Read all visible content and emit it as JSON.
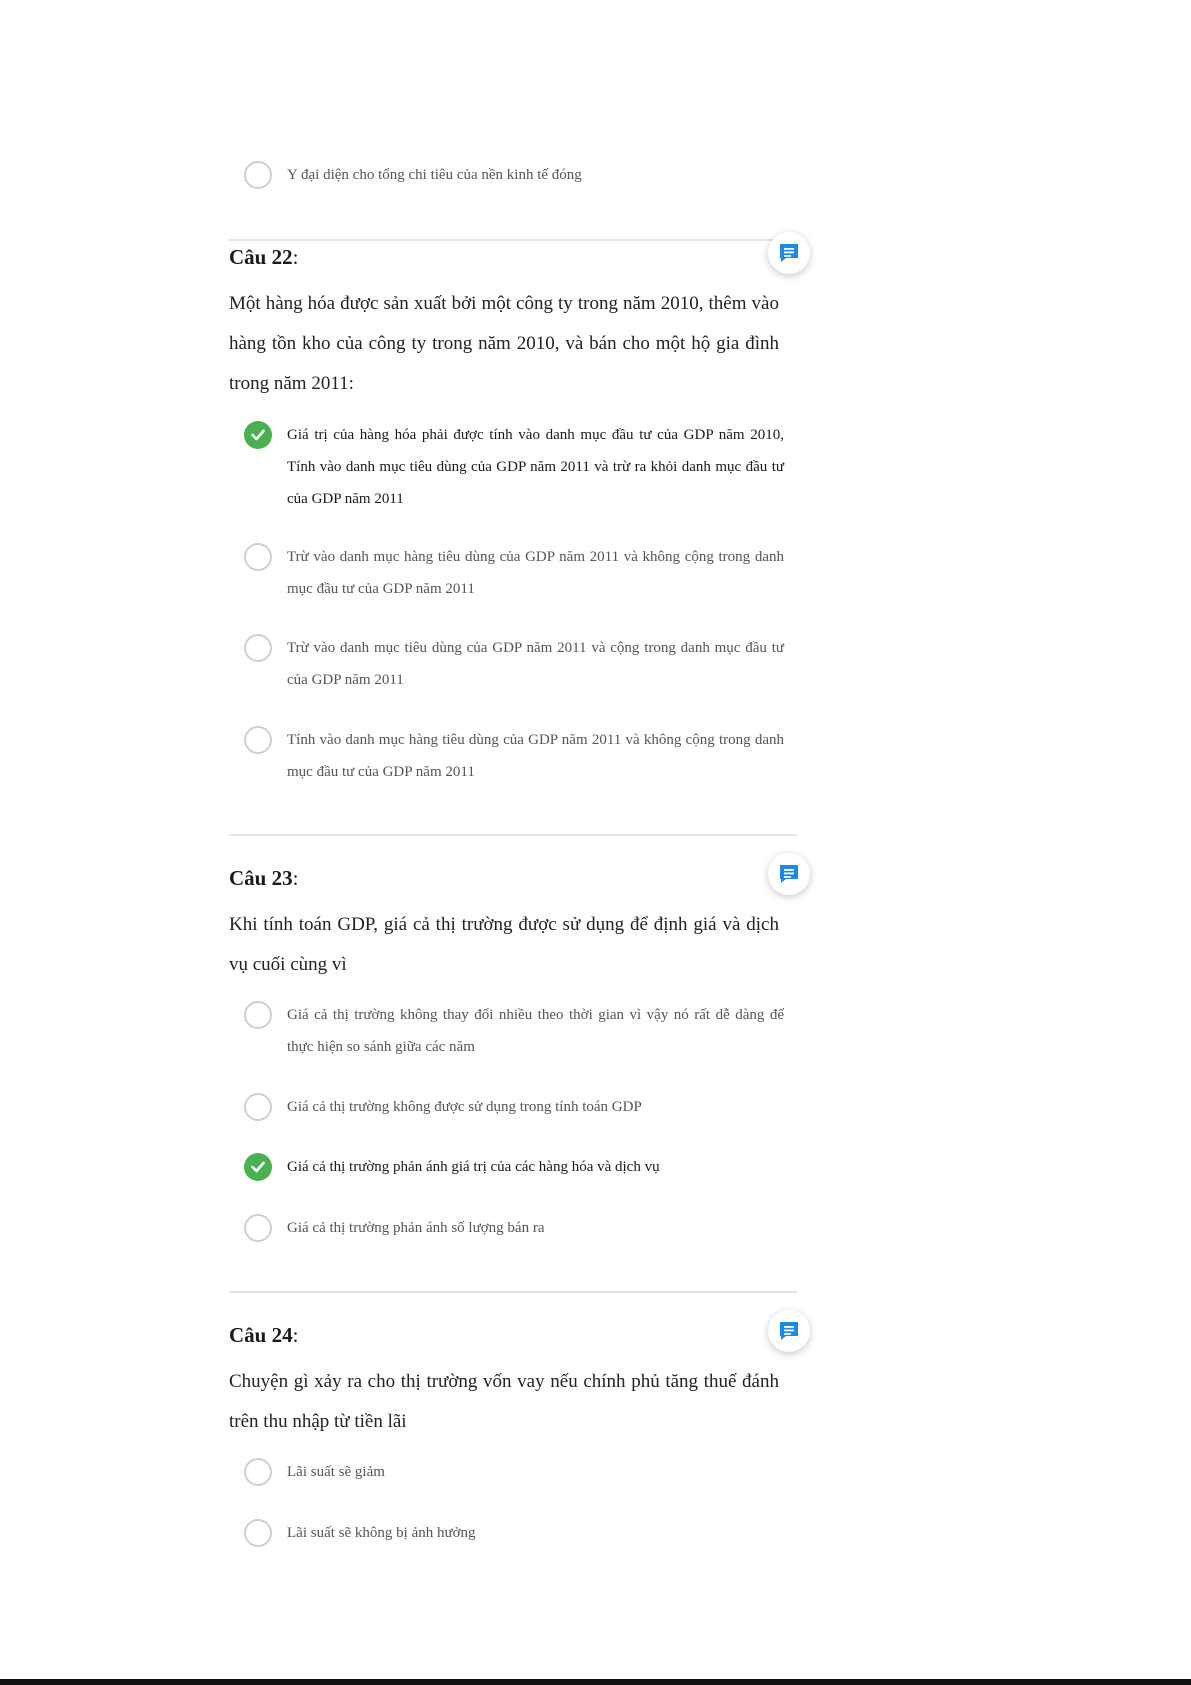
{
  "q21": {
    "options": [
      {
        "text": "Y đại diện cho tổng chi tiêu của nền kinh tế đóng",
        "selected": false
      }
    ]
  },
  "q22": {
    "label": "Câu 22",
    "colon": ":",
    "text": "Một hàng hóa được sản xuất bởi một công ty trong năm 2010, thêm vào hàng tồn kho của công ty trong năm 2010, và bán cho một hộ gia đình trong năm 2011:",
    "options": [
      {
        "text": "Giá trị của hàng hóa phải được tính vào danh mục đầu tư của GDP năm 2010, Tính vào danh mục tiêu dùng của GDP năm 2011 và trừ ra khỏi danh mục đầu tư của GDP năm 2011",
        "selected": true
      },
      {
        "text": "Trừ vào danh mục hàng tiêu dùng của GDP năm 2011 và không cộng trong danh mục đầu tư của GDP năm 2011",
        "selected": false
      },
      {
        "text": "Trừ vào danh mục tiêu dùng của GDP năm 2011 và cộng trong danh mục đầu tư của GDP năm 2011",
        "selected": false
      },
      {
        "text": "Tính vào danh mục hàng tiêu dùng của GDP năm 2011 và không cộng trong danh mục đầu tư của GDP năm 2011",
        "selected": false
      }
    ]
  },
  "q23": {
    "label": "Câu 23",
    "colon": ":",
    "text": "Khi tính toán GDP, giá cả thị trường được sử dụng để định giá và dịch vụ cuối cùng vì",
    "options": [
      {
        "text": "Giá cả thị trường không thay đổi nhiều theo thời gian vì vậy nó rất dễ dàng để thực hiện so sánh giữa các năm",
        "selected": false
      },
      {
        "text": "Giá cả thị trường không được sử dụng trong tính toán GDP",
        "selected": false
      },
      {
        "text": "Giá cả thị trường phản ánh giá trị của các hàng hóa và dịch vụ",
        "selected": true
      },
      {
        "text": "Giá cả thị trường phản ánh số lượng bán ra",
        "selected": false
      }
    ]
  },
  "q24": {
    "label": "Câu 24",
    "colon": ":",
    "text": "Chuyện gì xảy ra cho thị trường vốn vay nếu chính phủ tăng thuế đánh trên thu nhập từ tiền lãi",
    "options": [
      {
        "text": "Lãi suất sẽ giảm",
        "selected": false
      },
      {
        "text": "Lãi suất sẽ không bị ảnh hưởng",
        "selected": false
      }
    ]
  },
  "colors": {
    "accent": "#1e88e5",
    "checked": "#4caf50",
    "radio_border": "#d0d0d0",
    "separator": "#e4e4e4"
  },
  "icons": {
    "comment": "comment-icon",
    "check": "check-icon"
  }
}
